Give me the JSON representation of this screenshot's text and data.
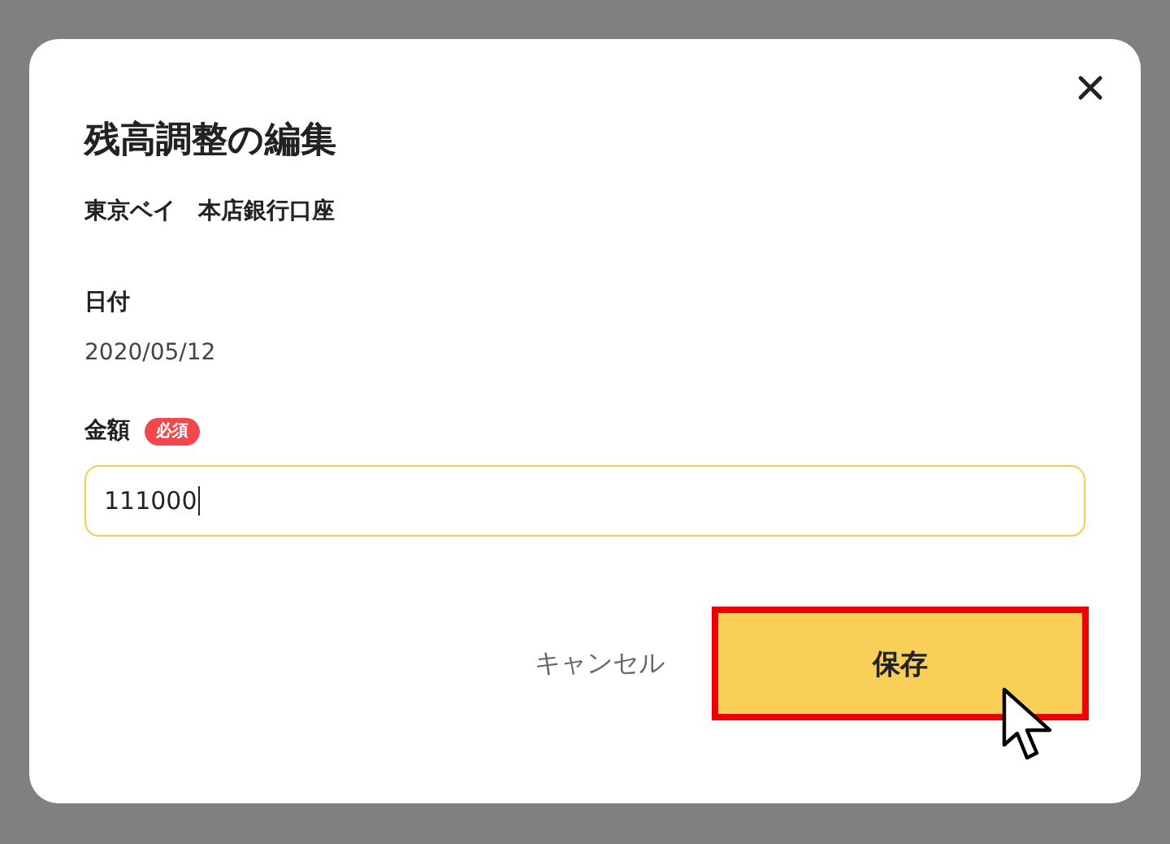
{
  "dialog": {
    "title": "残高調整の編集",
    "account": "東京ベイ　本店銀行口座",
    "date": {
      "label": "日付",
      "value": "2020/05/12"
    },
    "amount": {
      "label": "金額",
      "badge": "必須",
      "value": "111000",
      "focused": true
    },
    "buttons": [
      {
        "kind": "text",
        "label": "キャンセル",
        "highlighted": false
      },
      {
        "kind": "primary",
        "label": "保存",
        "highlighted": true
      }
    ]
  }
}
